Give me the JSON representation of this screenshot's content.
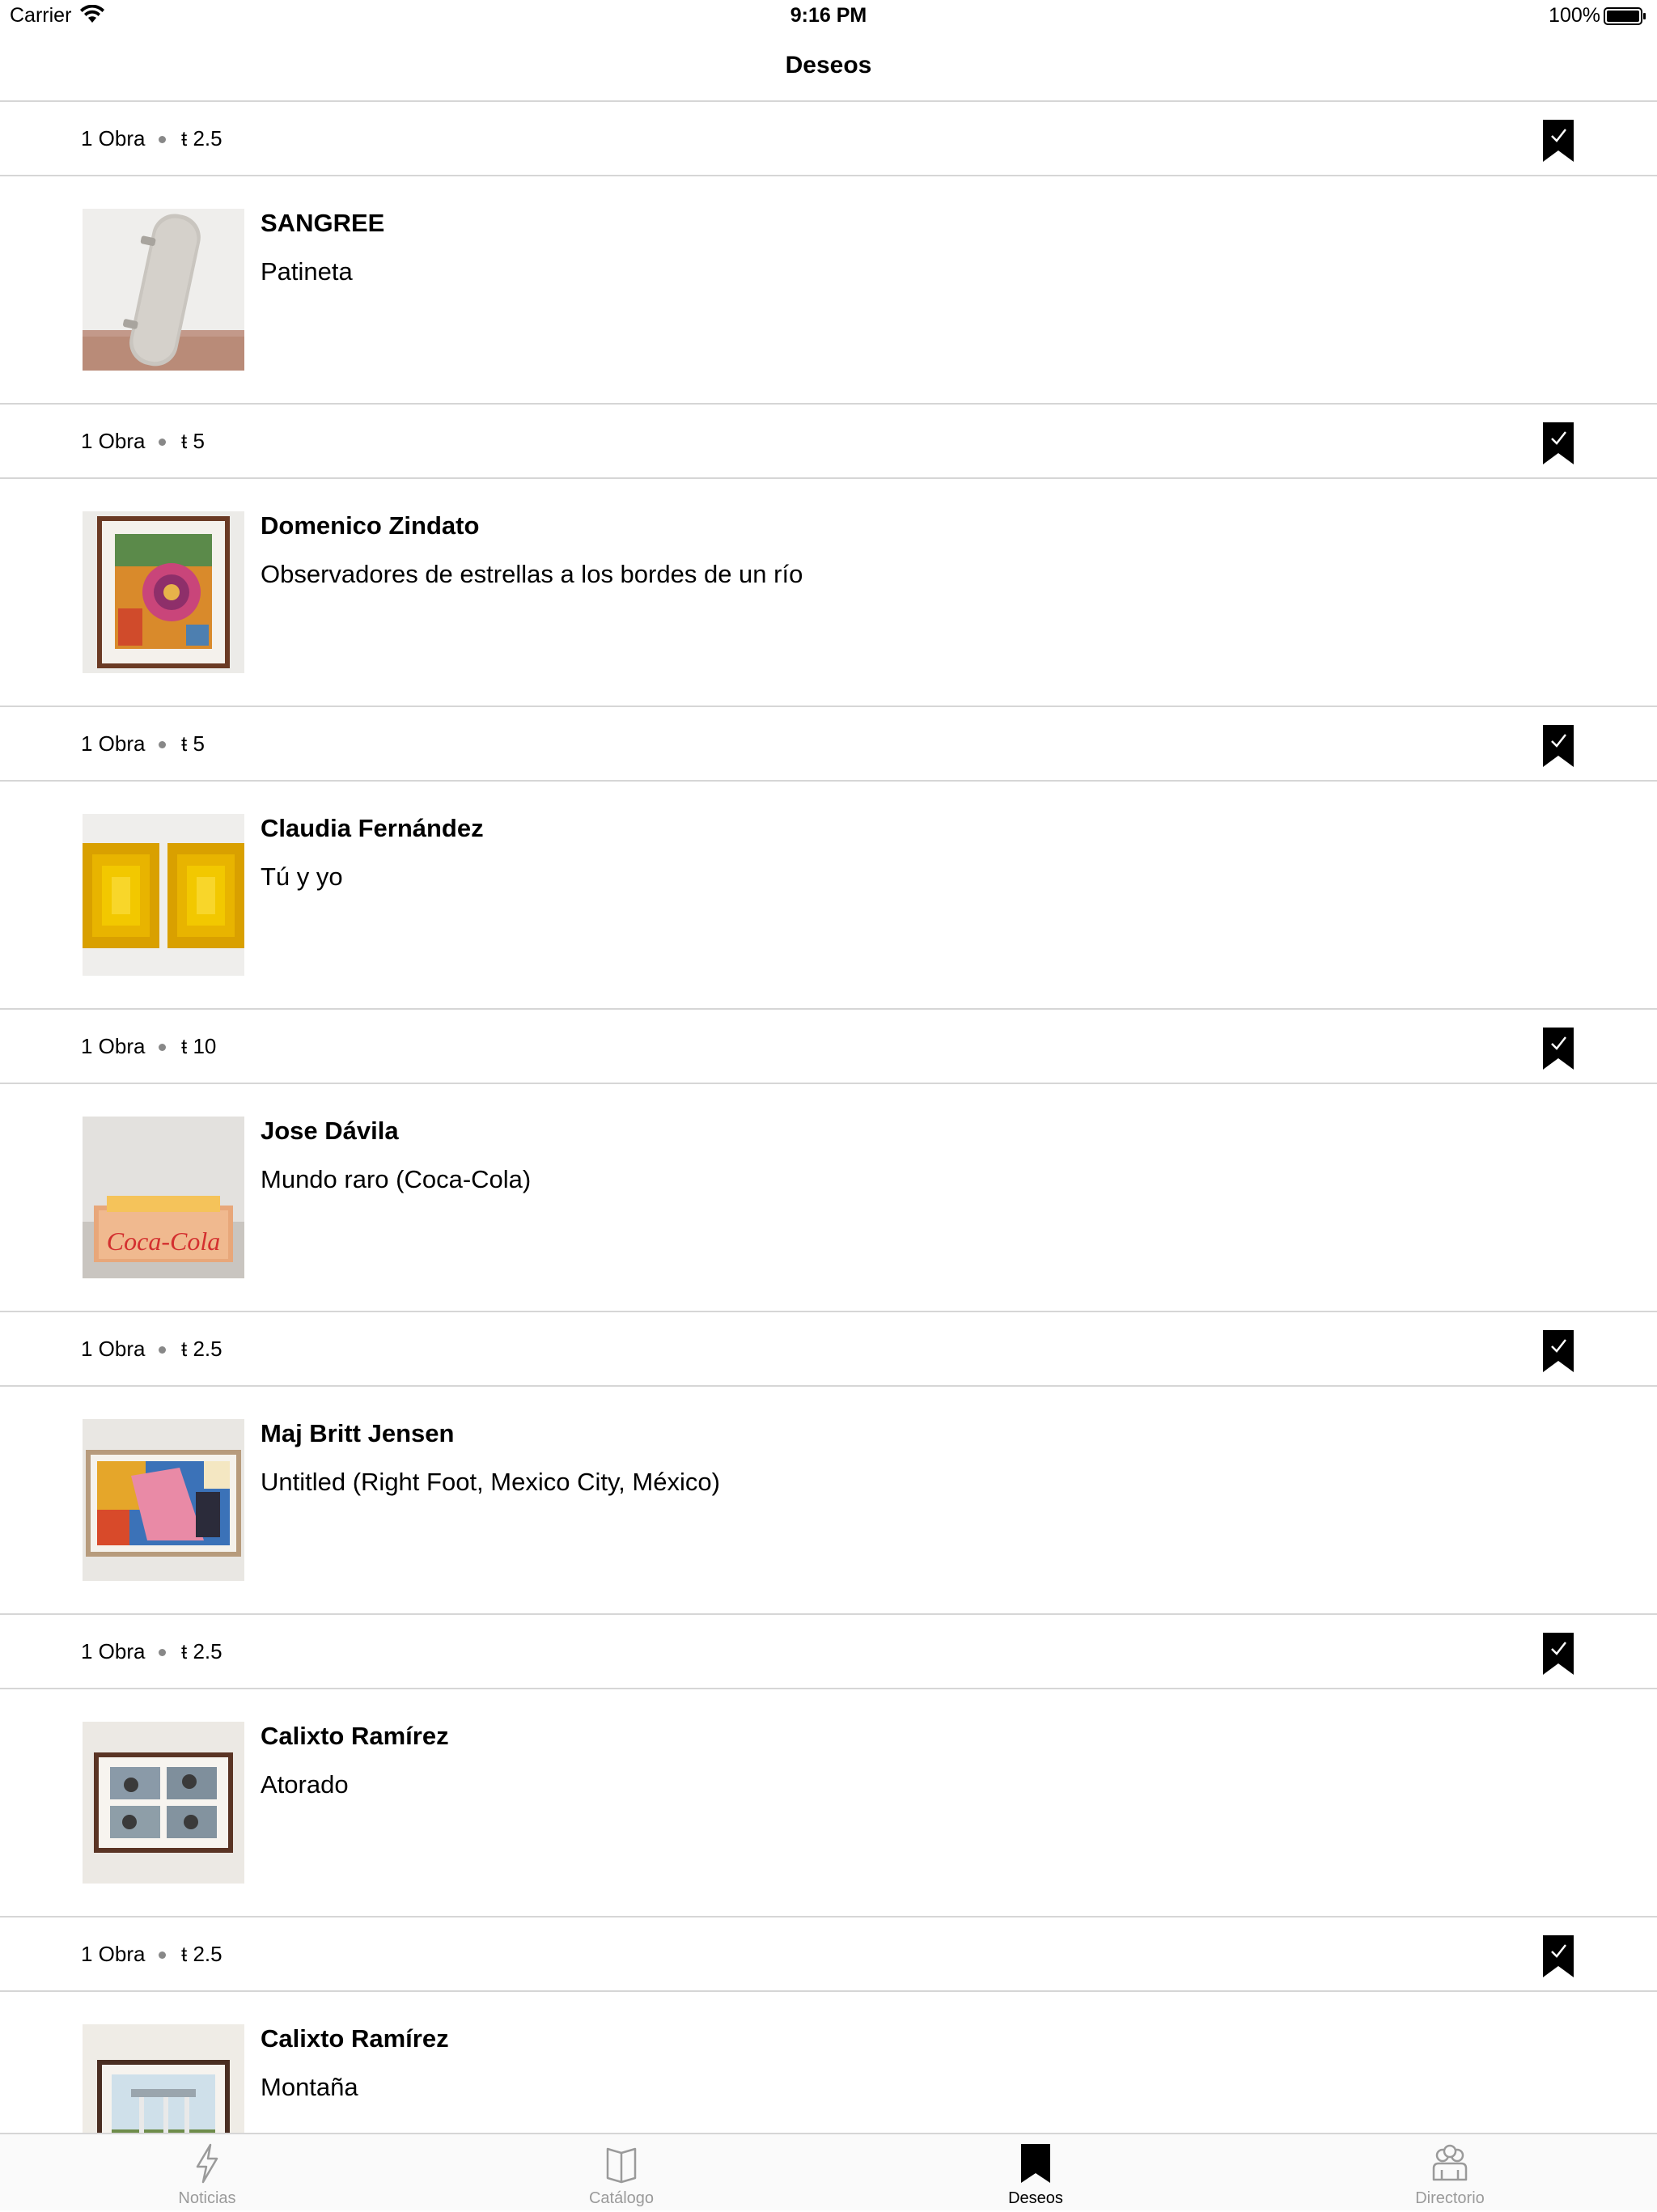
{
  "status_bar": {
    "carrier": "Carrier",
    "time": "9:16 PM",
    "battery": "100%"
  },
  "nav": {
    "title": "Deseos"
  },
  "items": [
    {
      "count": "1 Obra",
      "price": "ŧ 2.5",
      "artist": "SANGREE",
      "title": "Patineta",
      "thumb": "skateboard"
    },
    {
      "count": "1 Obra",
      "price": "ŧ 5",
      "artist": "Domenico Zindato",
      "title": "Observadores de estrellas a los bordes de un río",
      "thumb": "framed-colorful"
    },
    {
      "count": "1 Obra",
      "price": "ŧ 5",
      "artist": "Claudia Fernández",
      "title": "Tú y yo",
      "thumb": "yellow-panels"
    },
    {
      "count": "1 Obra",
      "price": "ŧ 10",
      "artist": "Jose Dávila",
      "title": "Mundo raro (Coca-Cola)",
      "thumb": "coca-cola-box",
      "thumb_text": "Coca-Cola"
    },
    {
      "count": "1 Obra",
      "price": "ŧ 2.5",
      "artist": "Maj Britt Jensen",
      "title": "Untitled (Right Foot, Mexico City, México)",
      "thumb": "framed-collage"
    },
    {
      "count": "1 Obra",
      "price": "ŧ 2.5",
      "artist": "Calixto Ramírez",
      "title": "Atorado",
      "thumb": "framed-photos"
    },
    {
      "count": "1 Obra",
      "price": "ŧ 2.5",
      "artist": "Calixto Ramírez",
      "title": "Montaña",
      "thumb": "framed-landscape"
    }
  ],
  "tabs": [
    {
      "label": "Noticias",
      "icon": "lightning-icon",
      "active": false
    },
    {
      "label": "Catálogo",
      "icon": "book-icon",
      "active": false
    },
    {
      "label": "Deseos",
      "icon": "bookmark-icon",
      "active": true
    },
    {
      "label": "Directorio",
      "icon": "people-icon",
      "active": false
    }
  ],
  "colors": {
    "divider": "#d6d6d6",
    "inactive_tab": "#9a9a9a",
    "active_tab": "#000000"
  }
}
